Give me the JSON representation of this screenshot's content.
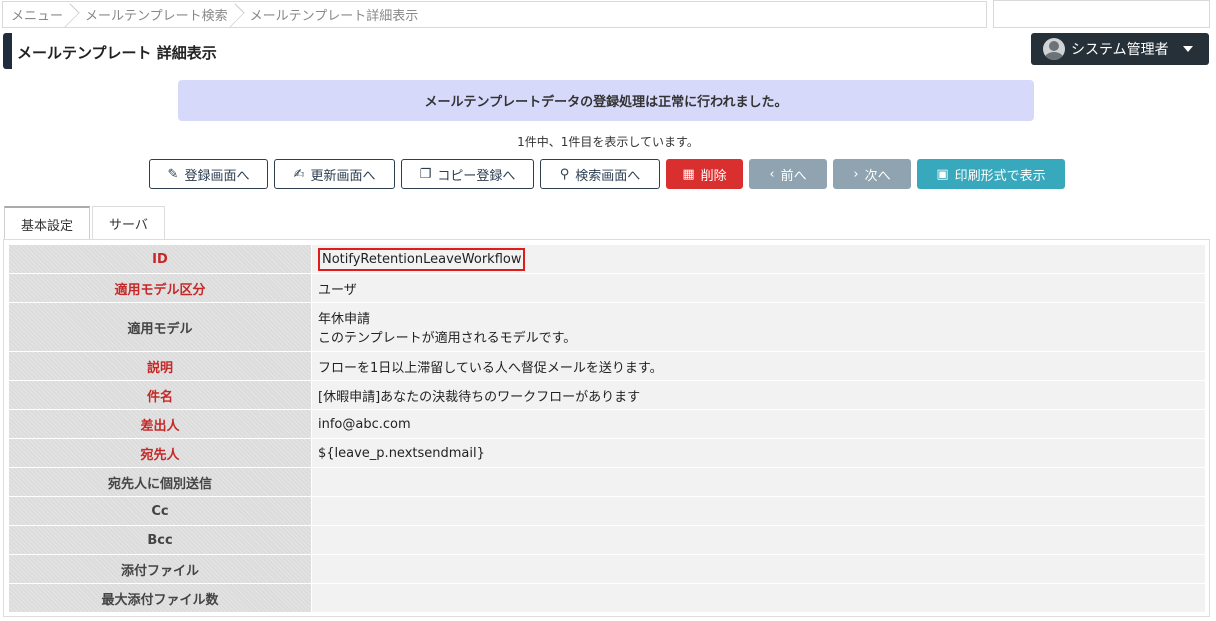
{
  "breadcrumb": [
    "メニュー",
    "メールテンプレート検索",
    "メールテンプレート詳細表示"
  ],
  "header": {
    "title": "メールテンプレート 詳細表示",
    "user": "システム管理者"
  },
  "message": "メールテンプレートデータの登録処理は正常に行われました。",
  "count": "1件中、1件目を表示しています。",
  "buttons": {
    "register": "登録画面へ",
    "update": "更新画面へ",
    "copy": "コピー登録へ",
    "search": "検索画面へ",
    "delete": "削除",
    "prev": "前へ",
    "next": "次へ",
    "print": "印刷形式で表示"
  },
  "tabs": [
    "基本設定",
    "サーバ"
  ],
  "rows": [
    {
      "label": "ID",
      "value": "NotifyRetentionLeaveWorkflow",
      "required": true
    },
    {
      "label": "適用モデル区分",
      "value": "ユーザ",
      "required": true
    },
    {
      "label": "適用モデル",
      "value": "年休申請",
      "value2": "このテンプレートが適用されるモデルです。",
      "required": false
    },
    {
      "label": "説明",
      "value": "フローを1日以上滞留している人へ督促メールを送ります。",
      "required": true
    },
    {
      "label": "件名",
      "value": "[休暇申請]あなたの決裁待ちのワークフローがあります",
      "required": true
    },
    {
      "label": "差出人",
      "value": "info@abc.com",
      "required": true
    },
    {
      "label": "宛先人",
      "value": "${leave_p.nextsendmail}",
      "required": true
    },
    {
      "label": "宛先人に個別送信",
      "value": "",
      "required": false
    },
    {
      "label": "Cc",
      "value": "",
      "required": false
    },
    {
      "label": "Bcc",
      "value": "",
      "required": false
    },
    {
      "label": "添付ファイル",
      "value": "",
      "required": false
    },
    {
      "label": "最大添付ファイル数",
      "value": "",
      "required": false
    }
  ],
  "colors": {
    "danger": "#d9302f",
    "info": "#38a9bd",
    "gray": "#8fa3b1",
    "dark": "#253038",
    "required": "#c62828"
  }
}
